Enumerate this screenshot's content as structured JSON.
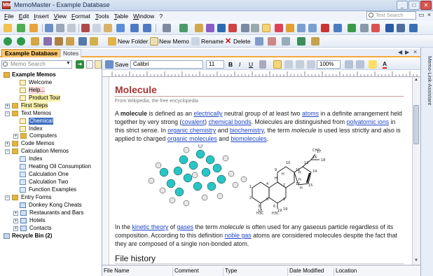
{
  "app": {
    "title": "MemoMaster - Example Database",
    "icon_text": "MM"
  },
  "window_buttons": {
    "minimize": "_",
    "maximize": "□",
    "close": "✕"
  },
  "menu": [
    "File",
    "Edit",
    "Insert",
    "View",
    "Format",
    "Tools",
    "Table",
    "Window",
    "?"
  ],
  "search": {
    "placeholder": "Text Search"
  },
  "toolbar2": {
    "new_folder": "New Folder",
    "new_memo": "New Memo",
    "rename": "Rename",
    "delete": "Delete"
  },
  "tabs": {
    "database": "Example Database",
    "notes": "Notes"
  },
  "left_panel": {
    "search_placeholder": "Memo Search",
    "tree": [
      {
        "label": "Example Memos",
        "bold": true
      },
      {
        "label": "Welcome"
      },
      {
        "label": "Help..."
      },
      {
        "label": "Product Tour"
      },
      {
        "label": "First Steps"
      },
      {
        "label": "Text Memos"
      },
      {
        "label": "Chemical"
      },
      {
        "label": "Index"
      },
      {
        "label": "Computers"
      },
      {
        "label": "Code Memos"
      },
      {
        "label": "Calculation Memos"
      },
      {
        "label": "Index"
      },
      {
        "label": "Heating Oil Consumption"
      },
      {
        "label": "Calculation One"
      },
      {
        "label": "Calculation Two"
      },
      {
        "label": "Function Examples"
      },
      {
        "label": "Entry Forms"
      },
      {
        "label": "Donkey Kong Cheats"
      },
      {
        "label": "Restaurants and Bars"
      },
      {
        "label": "Hotels"
      },
      {
        "label": "Contacts"
      },
      {
        "label": "Recycle Bin (2)",
        "bold": true
      }
    ]
  },
  "editor_toolbar": {
    "save": "Save",
    "font": "Calibri",
    "size": "11",
    "zoom": "100%",
    "bold": "B",
    "italic": "I",
    "underline": "U"
  },
  "document": {
    "title": "Molecule",
    "source": "From Wikipedia, the free encyclopedia",
    "p1": [
      {
        "t": "A "
      },
      {
        "t": "molecule",
        "b": true
      },
      {
        "t": " is defined as an "
      },
      {
        "t": "electrically",
        "l": true
      },
      {
        "t": " neutral group of at least two "
      },
      {
        "t": "atoms",
        "l": true
      },
      {
        "t": " in a definite arrangement held together by very strong ("
      },
      {
        "t": "covalent",
        "l": true
      },
      {
        "t": ") "
      },
      {
        "t": "chemical bonds",
        "l": true
      },
      {
        "t": ". Molecules are distinguished from "
      },
      {
        "t": "polyatomic ions",
        "l": true
      },
      {
        "t": " in this strict sense. In "
      },
      {
        "t": "organic chemistry",
        "l": true
      },
      {
        "t": " and "
      },
      {
        "t": "biochemistry",
        "l": true
      },
      {
        "t": ", the term "
      },
      {
        "t": "molecule",
        "i": true
      },
      {
        "t": " is used less strictly and also is applied to charged "
      },
      {
        "t": "organic molecules",
        "l": true
      },
      {
        "t": " and "
      },
      {
        "t": "biomolecules",
        "l": true
      },
      {
        "t": "."
      }
    ],
    "p2": [
      {
        "t": "In the "
      },
      {
        "t": "kinetic theory",
        "l": true
      },
      {
        "t": " of "
      },
      {
        "t": "gases",
        "l": true
      },
      {
        "t": " the term "
      },
      {
        "t": "molecule",
        "i": true
      },
      {
        "t": " is often used for any gaseous particle regardless of its composition. According to this definition "
      },
      {
        "t": "noble gas",
        "l": true
      },
      {
        "t": " atoms are considered molecules despite the fact that they are composed of a single non-bonded atom."
      }
    ],
    "file_history": "File history",
    "diagram_labels": [
      "1",
      "2",
      "3",
      "4",
      "5",
      "6",
      "7",
      "8",
      "9",
      "10",
      "11",
      "12",
      "13",
      "14",
      "15",
      "16",
      "17",
      "18",
      "19",
      "H",
      "H",
      "H"
    ],
    "diagram_subscripts": [
      "H",
      "H",
      "H3C",
      "CH3",
      "H3C"
    ],
    "diagram_caption_labels": [
      "18",
      "19"
    ]
  },
  "grid_columns": [
    "File Name",
    "Comment",
    "Type",
    "Date Modified",
    "Location"
  ],
  "right_panel": {
    "label": "Memo-Link-Assistant"
  }
}
